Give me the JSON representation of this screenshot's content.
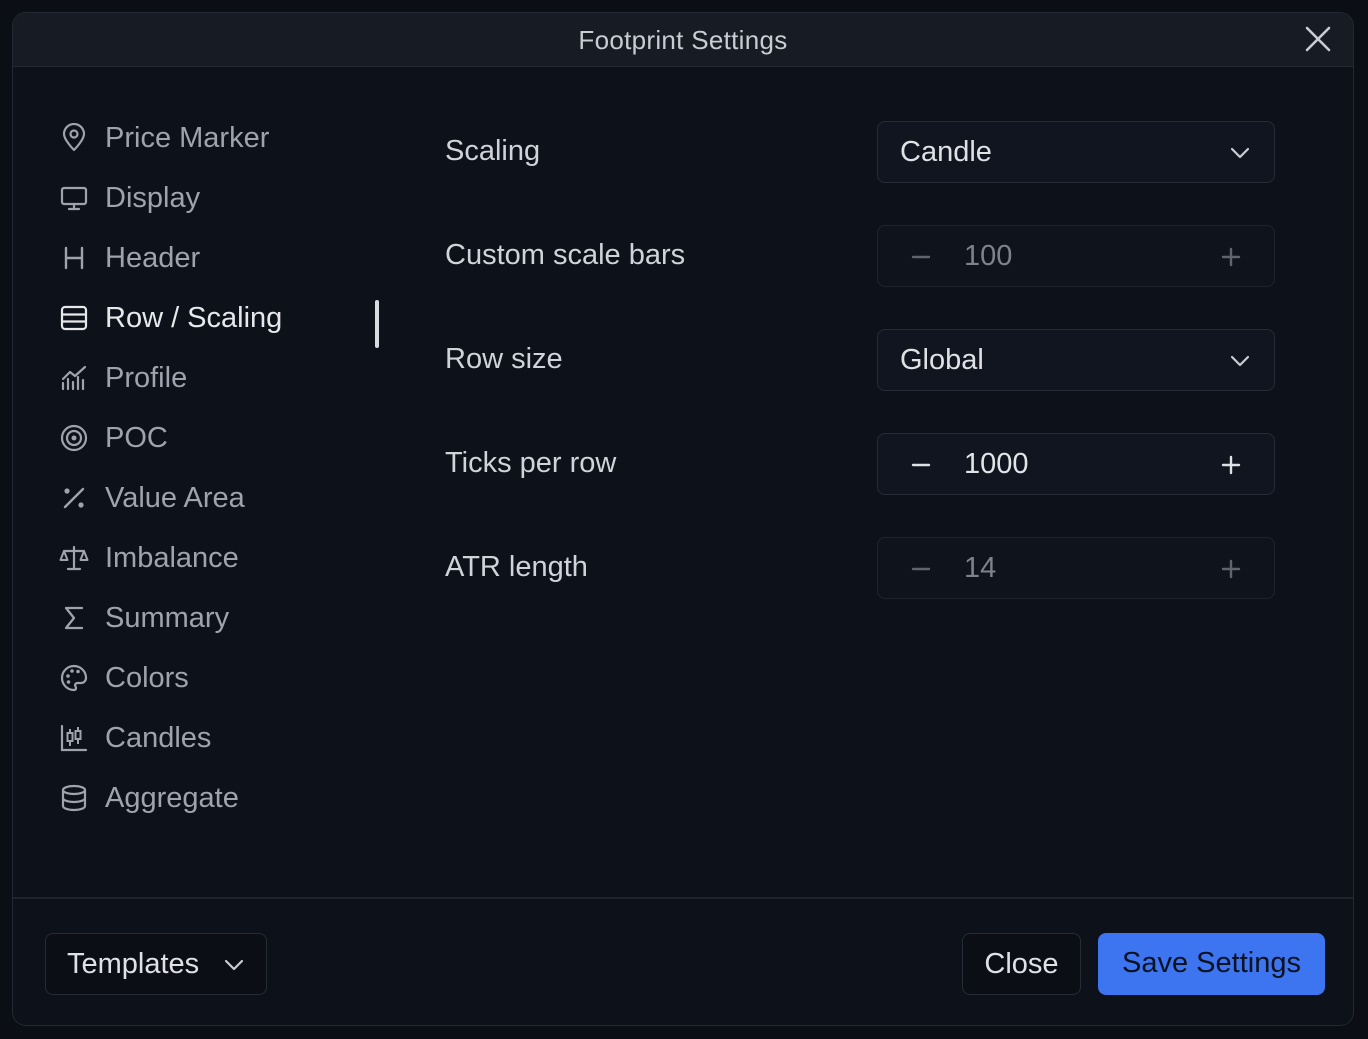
{
  "dialog": {
    "title": "Footprint Settings"
  },
  "sidebar": {
    "items": [
      {
        "label": "Price Marker",
        "icon": "map-pin-icon"
      },
      {
        "label": "Display",
        "icon": "monitor-icon"
      },
      {
        "label": "Header",
        "icon": "heading-icon"
      },
      {
        "label": "Row / Scaling",
        "icon": "rows-icon",
        "active": true
      },
      {
        "label": "Profile",
        "icon": "chart-profile-icon"
      },
      {
        "label": "POC",
        "icon": "target-icon"
      },
      {
        "label": "Value Area",
        "icon": "percent-icon"
      },
      {
        "label": "Imbalance",
        "icon": "scale-icon"
      },
      {
        "label": "Summary",
        "icon": "sigma-icon"
      },
      {
        "label": "Colors",
        "icon": "palette-icon"
      },
      {
        "label": "Candles",
        "icon": "candles-icon"
      },
      {
        "label": "Aggregate",
        "icon": "database-icon"
      }
    ]
  },
  "settings": {
    "scaling": {
      "label": "Scaling",
      "value": "Candle"
    },
    "custom_scale_bars": {
      "label": "Custom scale bars",
      "value": "100",
      "disabled": true
    },
    "row_size": {
      "label": "Row size",
      "value": "Global"
    },
    "ticks_per_row": {
      "label": "Ticks per row",
      "value": "1000",
      "disabled": false
    },
    "atr_length": {
      "label": "ATR length",
      "value": "14",
      "disabled": true
    }
  },
  "footer": {
    "templates_label": "Templates",
    "close_label": "Close",
    "save_label": "Save Settings"
  },
  "colors": {
    "accent": "#3d74f0",
    "background": "#0d1119",
    "text": "#d0d3d9"
  }
}
